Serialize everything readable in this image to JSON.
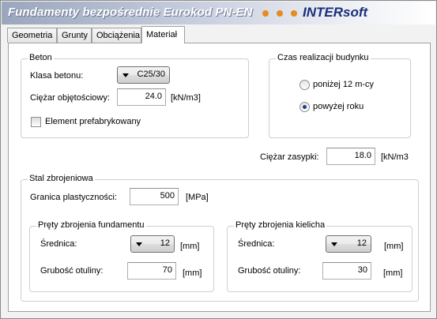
{
  "window": {
    "title": "Fundamenty bezpośrednie Eurokod PN-EN",
    "brand": "INTERsoft"
  },
  "tabs": [
    {
      "label": "Geometria",
      "active": false
    },
    {
      "label": "Grunty",
      "active": false
    },
    {
      "label": "Obciążenia",
      "active": false
    },
    {
      "label": "Materiał",
      "active": true
    }
  ],
  "beton": {
    "legend": "Beton",
    "klasa_label": "Klasa betonu:",
    "klasa_value": "C25/30",
    "ciezar_label": "Ciężar objętościowy:",
    "ciezar_value": "24.0",
    "ciezar_unit": "[kN/m3]",
    "prefab_label": "Element prefabrykowany",
    "prefab_checked": false
  },
  "czas": {
    "legend": "Czas realizacji budynku",
    "option1": "poniżej 12 m-cy",
    "option2": "powyżej roku",
    "selected": 2
  },
  "zasypka": {
    "label": "Ciężar zasypki:",
    "value": "18.0",
    "unit": "[kN/m3"
  },
  "stal": {
    "legend": "Stal zbrojeniowa",
    "granica_label": "Granica plastyczności:",
    "granica_value": "500",
    "granica_unit": "[MPa]",
    "fundament": {
      "legend": "Pręty zbrojenia fundamentu",
      "srednica_label": "Średnica:",
      "srednica_value": "12",
      "srednica_unit": "[mm]",
      "otulina_label": "Grubość otuliny:",
      "otulina_value": "70",
      "otulina_unit": "[mm]"
    },
    "kielich": {
      "legend": "Pręty zbrojenia kielicha",
      "srednica_label": "Średnica:",
      "srednica_value": "12",
      "srednica_unit": "[mm]",
      "otulina_label": "Grubość otuliny:",
      "otulina_value": "30",
      "otulina_unit": "[mm]"
    }
  },
  "colors": {
    "accent_dots": "#e88a1e",
    "brand": "#1a2f7a",
    "radio_selected": "#1b3f86"
  }
}
